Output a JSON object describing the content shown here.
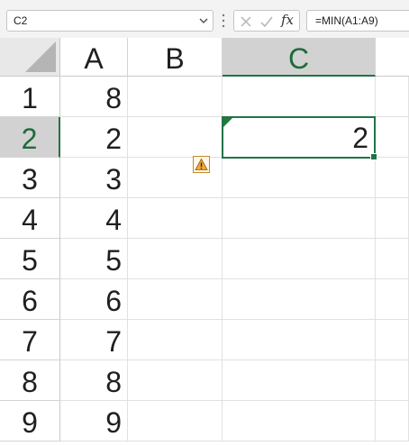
{
  "name_box": {
    "value": "C2",
    "dropdown_icon": "chevron-down-icon"
  },
  "formula_bar": {
    "cancel_icon": "cancel-icon",
    "enter_icon": "checkmark-icon",
    "insert_function_label": "fx",
    "formula": "=MIN(A1:A9)"
  },
  "columns": [
    {
      "label": "A",
      "active": false
    },
    {
      "label": "B",
      "active": false
    },
    {
      "label": "C",
      "active": true
    }
  ],
  "rows": [
    {
      "label": "1",
      "A": "8",
      "B": "",
      "C": ""
    },
    {
      "label": "2",
      "A": "2",
      "B": "",
      "C": "2"
    },
    {
      "label": "3",
      "A": "3",
      "B": "",
      "C": ""
    },
    {
      "label": "4",
      "A": "4",
      "B": "",
      "C": ""
    },
    {
      "label": "5",
      "A": "5",
      "B": "",
      "C": ""
    },
    {
      "label": "6",
      "A": "6",
      "B": "",
      "C": ""
    },
    {
      "label": "7",
      "A": "7",
      "B": "",
      "C": ""
    },
    {
      "label": "8",
      "A": "8",
      "B": "",
      "C": ""
    },
    {
      "label": "9",
      "A": "9",
      "B": "",
      "C": ""
    }
  ],
  "selection": {
    "cell": "C2",
    "value": "2",
    "has_error_indicator": true,
    "warning_icon": "warning-icon"
  },
  "colors": {
    "accent": "#217346",
    "header_active_bg": "#d2d2d2",
    "warning": "#f2a93b"
  }
}
